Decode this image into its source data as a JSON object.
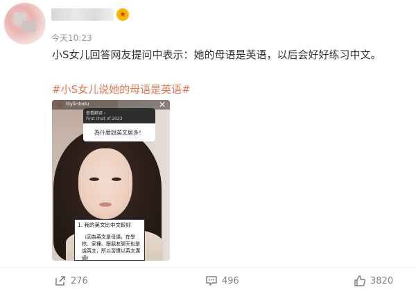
{
  "author": {
    "avatar_icon": "avatar-blurred",
    "name_hidden": true,
    "badge_icon": "vip-badge-icon"
  },
  "timestamp": "今天10:23",
  "post": {
    "text": "小S女儿回答网友提问中表示：她的母语是英语，以后会好好练习中文。",
    "hashtag": "#小S女儿说她的母语是英语#"
  },
  "media": {
    "story_handle": "lilylinbalu",
    "question_chip": "查看翻译 ›",
    "question_sub": "First chat of 2023",
    "question": "為什麼說英文居多！",
    "answer_title": "1. 我的英文比中文較好",
    "answer_detail": "（因為英文是母語，在學校、家裡、跟朋友聊天也是說英文，所以習慣以英文溝通）"
  },
  "actions": {
    "repost": {
      "icon": "share-icon",
      "count": "276"
    },
    "comment": {
      "icon": "comment-icon",
      "count": "496"
    },
    "like": {
      "icon": "thumbs-up-icon",
      "count": "3820"
    }
  },
  "colors": {
    "hashtag": "#eb7350",
    "meta": "#939393",
    "count": "#808080"
  }
}
